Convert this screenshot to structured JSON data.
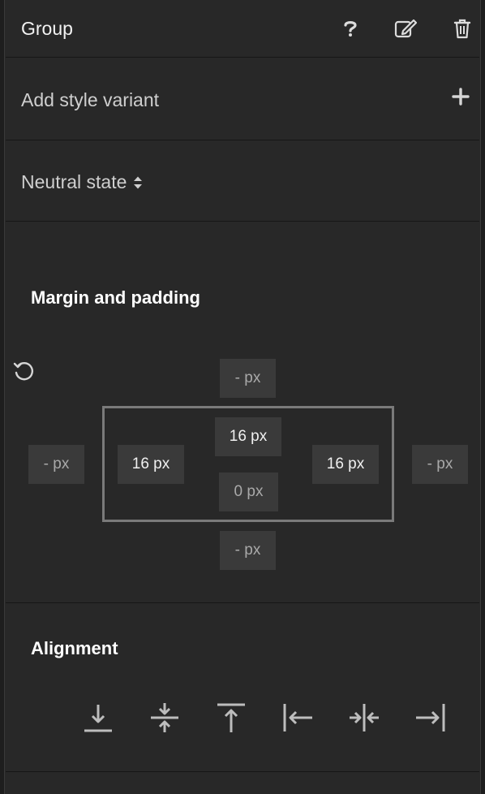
{
  "panel": {
    "title": "Group",
    "add_variant_label": "Add style variant",
    "state_label": "Neutral state"
  },
  "icons": {
    "help": "question-icon",
    "edit": "edit-icon",
    "delete": "trash-icon",
    "add": "plus-icon",
    "state_toggle": "updown-caret-icon",
    "reset": "reset-icon"
  },
  "spacing": {
    "title": "Margin and padding",
    "margin_top": "- px",
    "margin_left": "- px",
    "margin_right": "- px",
    "margin_bottom": "- px",
    "padding_top": "16 px",
    "padding_left": "16 px",
    "padding_right": "16 px",
    "padding_bottom": "0 px"
  },
  "alignment": {
    "title": "Alignment",
    "buttons": [
      "align-bottom-icon",
      "align-vertical-center-icon",
      "align-top-icon",
      "align-left-icon",
      "align-horizontal-center-icon",
      "align-right-icon"
    ]
  },
  "colors": {
    "background": "#282828",
    "field": "#3a3a3a",
    "frame": "#7a7a7a",
    "icon": "#bdbdbd"
  }
}
